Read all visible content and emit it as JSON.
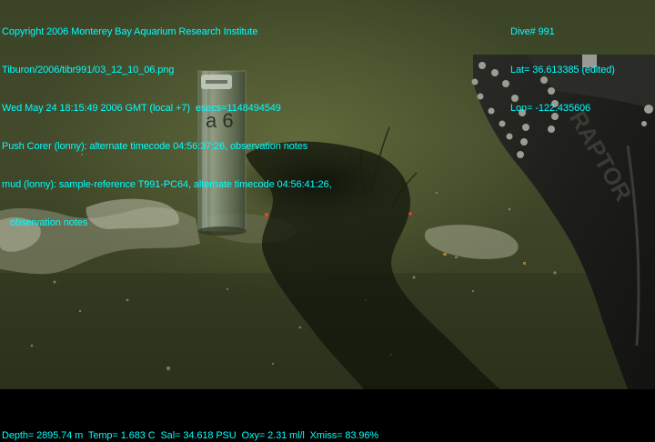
{
  "overlay": {
    "copyright": "Copyright 2006 Monterey Bay Aquarium Research Institute",
    "file_path": "Tiburon/2006/tibr991/03_12_10_06.png",
    "datetime": "Wed May 24 18:15:49 2006 GMT (local +7)  esecs=1148494549",
    "annotation_1": "Push Corer (lonny): alternate timecode 04:56:37:26, observation notes",
    "annotation_2_line1": "mud (lonny): sample-reference T991-PC64, alternate timecode 04:56:41:26,",
    "annotation_2_line2": "observation notes",
    "dive": "Dive# 991",
    "lat": "Lat= 36.613385 (edited)",
    "lon": "Lon= -122.435606",
    "telemetry": "Depth= 2895.74 m  Temp= 1.683 C  Sal= 34.618 PSU  Oxy= 2.31 ml/l  Xmiss= 83.96%"
  },
  "scene": {
    "core_tube_label": "a 6",
    "vehicle_label": "RAPTOR"
  },
  "colors": {
    "overlay_text": "#00ffff",
    "sediment": "#424a2b",
    "letterbox": "#000000"
  }
}
